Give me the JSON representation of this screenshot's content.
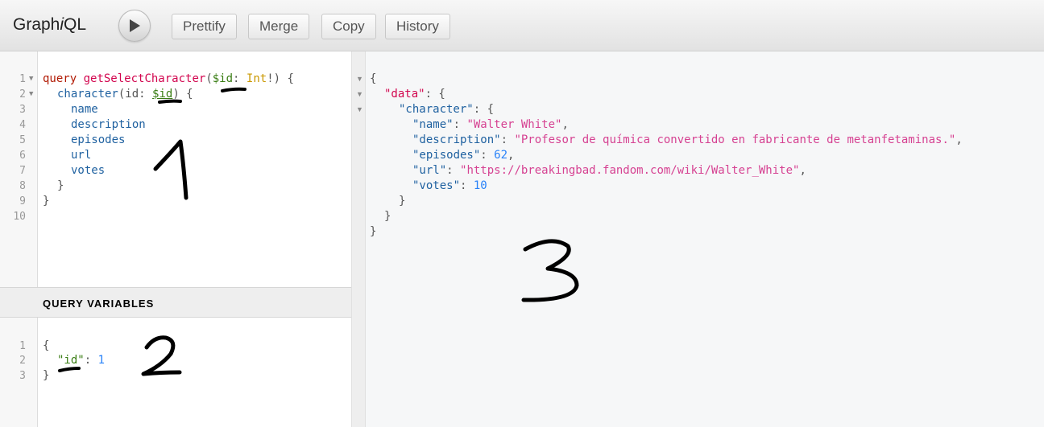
{
  "toolbar": {
    "title_prefix": "Graph",
    "title_i": "i",
    "title_suffix": "QL",
    "buttons": [
      "Prettify",
      "Merge",
      "Copy",
      "History"
    ]
  },
  "query_editor": {
    "line_numbers": [
      "1",
      "2",
      "3",
      "4",
      "5",
      "6",
      "7",
      "8",
      "9",
      "10"
    ],
    "lines": [
      {
        "kw": "query",
        "name": "getSelectCharacter",
        "open": "(",
        "var": "$id",
        "colon": ": ",
        "type": "Int",
        "rest": "!) {"
      },
      {
        "field": "character",
        "open": "(id: ",
        "var": "$id",
        "rest": ") {"
      },
      {
        "field": "name"
      },
      {
        "field": "description"
      },
      {
        "field": "episodes"
      },
      {
        "field": "url"
      },
      {
        "field": "votes"
      },
      {
        "punc": "}"
      },
      {
        "punc": "}"
      }
    ]
  },
  "variables_panel": {
    "title": "QUERY VARIABLES",
    "line_numbers": [
      "1",
      "2",
      "3"
    ],
    "open": "{",
    "key": "\"id\"",
    "colon": ": ",
    "value": "1",
    "close": "}"
  },
  "result": {
    "l1": "{",
    "data_key": "\"data\"",
    "character_key": "\"character\"",
    "brace_open": ": {",
    "fields": [
      {
        "key": "\"name\"",
        "value": "\"Walter White\"",
        "type": "string",
        "comma": ","
      },
      {
        "key": "\"description\"",
        "value": "\"Profesor de química convertido en fabricante de metanfetaminas.\"",
        "type": "string",
        "comma": ","
      },
      {
        "key": "\"episodes\"",
        "value": "62",
        "type": "number",
        "comma": ","
      },
      {
        "key": "\"url\"",
        "value": "\"https://breakingbad.fandom.com/wiki/Walter_White\"",
        "type": "string",
        "comma": ","
      },
      {
        "key": "\"votes\"",
        "value": "10",
        "type": "number",
        "comma": ""
      }
    ],
    "close": "}"
  },
  "annotations": [
    "1",
    "2",
    "3"
  ]
}
